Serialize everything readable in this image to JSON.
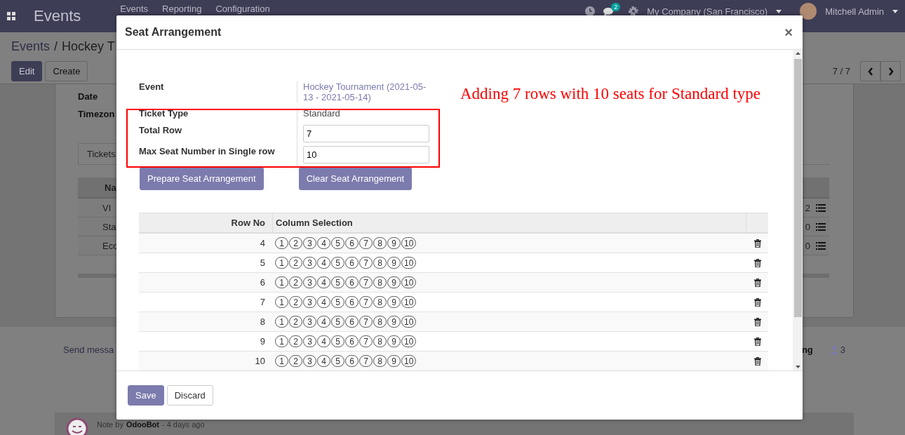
{
  "navbar": {
    "brand": "Events",
    "menu": [
      "Events",
      "Reporting",
      "Configuration"
    ],
    "chat_badge": "2",
    "company": "My Company (San Francisco)",
    "user": "Mitchell Admin"
  },
  "breadcrumb": [
    "Events",
    "/",
    "Hockey T"
  ],
  "actions": [
    "Edit",
    "Create"
  ],
  "pager": "7 / 7",
  "sheet": {
    "fields": [
      "Date",
      "Timezon"
    ],
    "tab": "Tickets",
    "table_header": "Na",
    "rows": [
      {
        "name": "VI",
        "count": "2"
      },
      {
        "name": "Sta",
        "count": "0"
      },
      {
        "name": "Eco",
        "count": "0"
      }
    ]
  },
  "chatter": {
    "send": "Send messa",
    "activity": "ng",
    "followers": "3",
    "note_prefix": "Note by",
    "note_author": "OdooBot",
    "note_time": "- 4 days ago"
  },
  "dialog": {
    "title": "Seat Arrangement",
    "close": "×",
    "event_label": "Event",
    "event_value": "Hockey Tournament (2021-05-13 - 2021-05-14)",
    "fields": [
      {
        "kind": "text",
        "label": "Ticket Type",
        "value": "Standard"
      },
      {
        "kind": "input",
        "label": "Total Row",
        "value": "7"
      },
      {
        "kind": "input",
        "label": "Max Seat Number in Single row",
        "value": "10"
      }
    ],
    "buttons": [
      "Prepare Seat Arrangement",
      "Clear Seat Arrangement"
    ],
    "annotation": "Adding 7 rows with 10 seats for Standard type",
    "columns": [
      "Row No",
      "Column Selection"
    ],
    "seat_rows": [
      {
        "row_no": "4",
        "seats": [
          "1",
          "2",
          "3",
          "4",
          "5",
          "6",
          "7",
          "8",
          "9",
          "10"
        ]
      },
      {
        "row_no": "5",
        "seats": [
          "1",
          "2",
          "3",
          "4",
          "5",
          "6",
          "7",
          "8",
          "9",
          "10"
        ]
      },
      {
        "row_no": "6",
        "seats": [
          "1",
          "2",
          "3",
          "4",
          "5",
          "6",
          "7",
          "8",
          "9",
          "10"
        ]
      },
      {
        "row_no": "7",
        "seats": [
          "1",
          "2",
          "3",
          "4",
          "5",
          "6",
          "7",
          "8",
          "9",
          "10"
        ]
      },
      {
        "row_no": "8",
        "seats": [
          "1",
          "2",
          "3",
          "4",
          "5",
          "6",
          "7",
          "8",
          "9",
          "10"
        ]
      },
      {
        "row_no": "9",
        "seats": [
          "1",
          "2",
          "3",
          "4",
          "5",
          "6",
          "7",
          "8",
          "9",
          "10"
        ]
      },
      {
        "row_no": "10",
        "seats": [
          "1",
          "2",
          "3",
          "4",
          "5",
          "6",
          "7",
          "8",
          "9",
          "10"
        ]
      }
    ],
    "footer": [
      "Save",
      "Discard"
    ]
  }
}
